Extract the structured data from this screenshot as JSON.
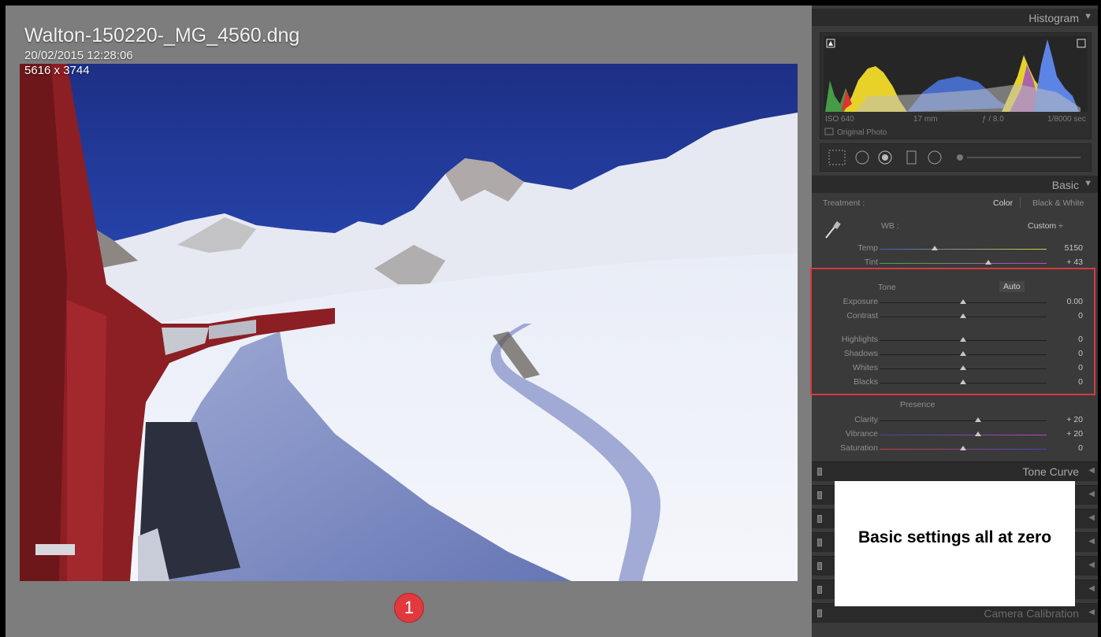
{
  "photo": {
    "filename": "Walton-150220-_MG_4560.dng",
    "datetime": "20/02/2015 12:28:06",
    "dimensions": "5616 x 3744"
  },
  "badge": "1",
  "histogram": {
    "header": "Histogram",
    "iso": "ISO 640",
    "focal_length": "17 mm",
    "aperture": "ƒ / 8.0",
    "shutter": "1/8000 sec",
    "original_photo_label": "Original Photo"
  },
  "basic": {
    "header": "Basic",
    "treatment_label": "Treatment :",
    "treatment_color": "Color",
    "treatment_bw": "Black & White",
    "wb_label": "WB :",
    "wb_value": "Custom ÷",
    "temp": {
      "label": "Temp",
      "value": "5150",
      "position": 0.33
    },
    "tint": {
      "label": "Tint",
      "value": "+ 43",
      "position": 0.65
    },
    "tone_label": "Tone",
    "auto_label": "Auto",
    "tone_sliders": [
      {
        "label": "Exposure",
        "value": "0.00",
        "position": 0.5
      },
      {
        "label": "Contrast",
        "value": "0",
        "position": 0.5
      },
      {
        "label": "Highlights",
        "value": "0",
        "position": 0.5
      },
      {
        "label": "Shadows",
        "value": "0",
        "position": 0.5
      },
      {
        "label": "Whites",
        "value": "0",
        "position": 0.5
      },
      {
        "label": "Blacks",
        "value": "0",
        "position": 0.5
      }
    ],
    "presence_label": "Presence",
    "presence_sliders": [
      {
        "label": "Clarity",
        "value": "+ 20",
        "position": 0.59
      },
      {
        "label": "Vibrance",
        "value": "+ 20",
        "position": 0.59
      },
      {
        "label": "Saturation",
        "value": "0",
        "position": 0.5
      }
    ]
  },
  "panels": {
    "tone_curve": "Tone Curve",
    "camera_calibration": "Camera Calibration"
  },
  "callout": "Basic settings all at zero",
  "colors": {
    "highlight_box": "#d9393e",
    "badge": "#e03a3e"
  },
  "icons": [
    "crop-overlay-icon",
    "spot-removal-icon",
    "red-eye-icon",
    "graduated-filter-icon",
    "radial-filter-icon",
    "adjustment-brush-icon",
    "eyedropper-icon"
  ]
}
